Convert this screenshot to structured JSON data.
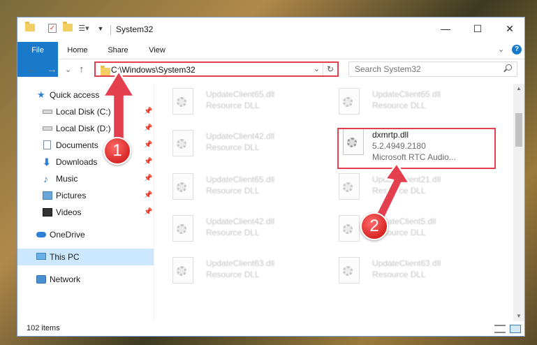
{
  "window": {
    "title": "System32",
    "controls": {
      "minimize": "—",
      "maximize": "☐",
      "close": "✕"
    }
  },
  "ribbon": {
    "tabs": [
      "File",
      "Home",
      "Share",
      "View"
    ],
    "expand_icon": "⌄",
    "help_icon": "?"
  },
  "nav": {
    "back_icon": "←",
    "forward_icon": "→",
    "recent_icon": "⌄",
    "up_icon": "↑",
    "address": "C:\\Windows\\System32",
    "address_dropdown_icon": "⌄",
    "refresh_icon": "↻",
    "search_placeholder": "Search System32"
  },
  "sidebar": {
    "items": [
      {
        "label": "Quick access",
        "icon": "star-icon",
        "pinned": false
      },
      {
        "label": "Local Disk (C:)",
        "icon": "disk-icon",
        "pinned": true
      },
      {
        "label": "Local Disk (D:)",
        "icon": "disk-icon",
        "pinned": true
      },
      {
        "label": "Documents",
        "icon": "documents-icon",
        "pinned": true
      },
      {
        "label": "Downloads",
        "icon": "download-icon",
        "pinned": true
      },
      {
        "label": "Music",
        "icon": "music-icon",
        "pinned": true
      },
      {
        "label": "Pictures",
        "icon": "pictures-icon",
        "pinned": true
      },
      {
        "label": "Videos",
        "icon": "videos-icon",
        "pinned": true
      },
      {
        "label": "OneDrive",
        "icon": "cloud-icon",
        "pinned": false
      },
      {
        "label": "This PC",
        "icon": "computer-icon",
        "pinned": false,
        "selected": true
      },
      {
        "label": "Network",
        "icon": "network-icon",
        "pinned": false
      }
    ],
    "pin_glyph": "📌"
  },
  "files": {
    "left_column": [
      {
        "name": "UpdateClient65.dll",
        "desc": "Resource DLL"
      },
      {
        "name": "UpdateClient42.dll",
        "desc": "Resource DLL"
      },
      {
        "name": "UpdateClient65.dll",
        "desc": "Resource DLL"
      },
      {
        "name": "UpdateClient42.dll",
        "desc": "Resource DLL"
      },
      {
        "name": "UpdateClient63.dll",
        "desc": "Resource DLL"
      }
    ],
    "right_column": [
      {
        "name": "UpdateClient65.dll",
        "desc": "Resource DLL"
      },
      {
        "name": "UpdateClient21.dll",
        "desc": "Resource DLL"
      },
      {
        "name": "UpdateClient5.dll",
        "desc": "Resource DLL"
      },
      {
        "name": "UpdateClient63.dll",
        "desc": "Resource DLL"
      }
    ],
    "highlighted": {
      "name": "dxmrtp.dll",
      "version": "5.2.4949.2180",
      "desc": "Microsoft RTC Audio..."
    }
  },
  "status": {
    "items_count": "102 items"
  },
  "annotations": {
    "badge1": "1",
    "badge2": "2",
    "color": "#e33f4e"
  }
}
